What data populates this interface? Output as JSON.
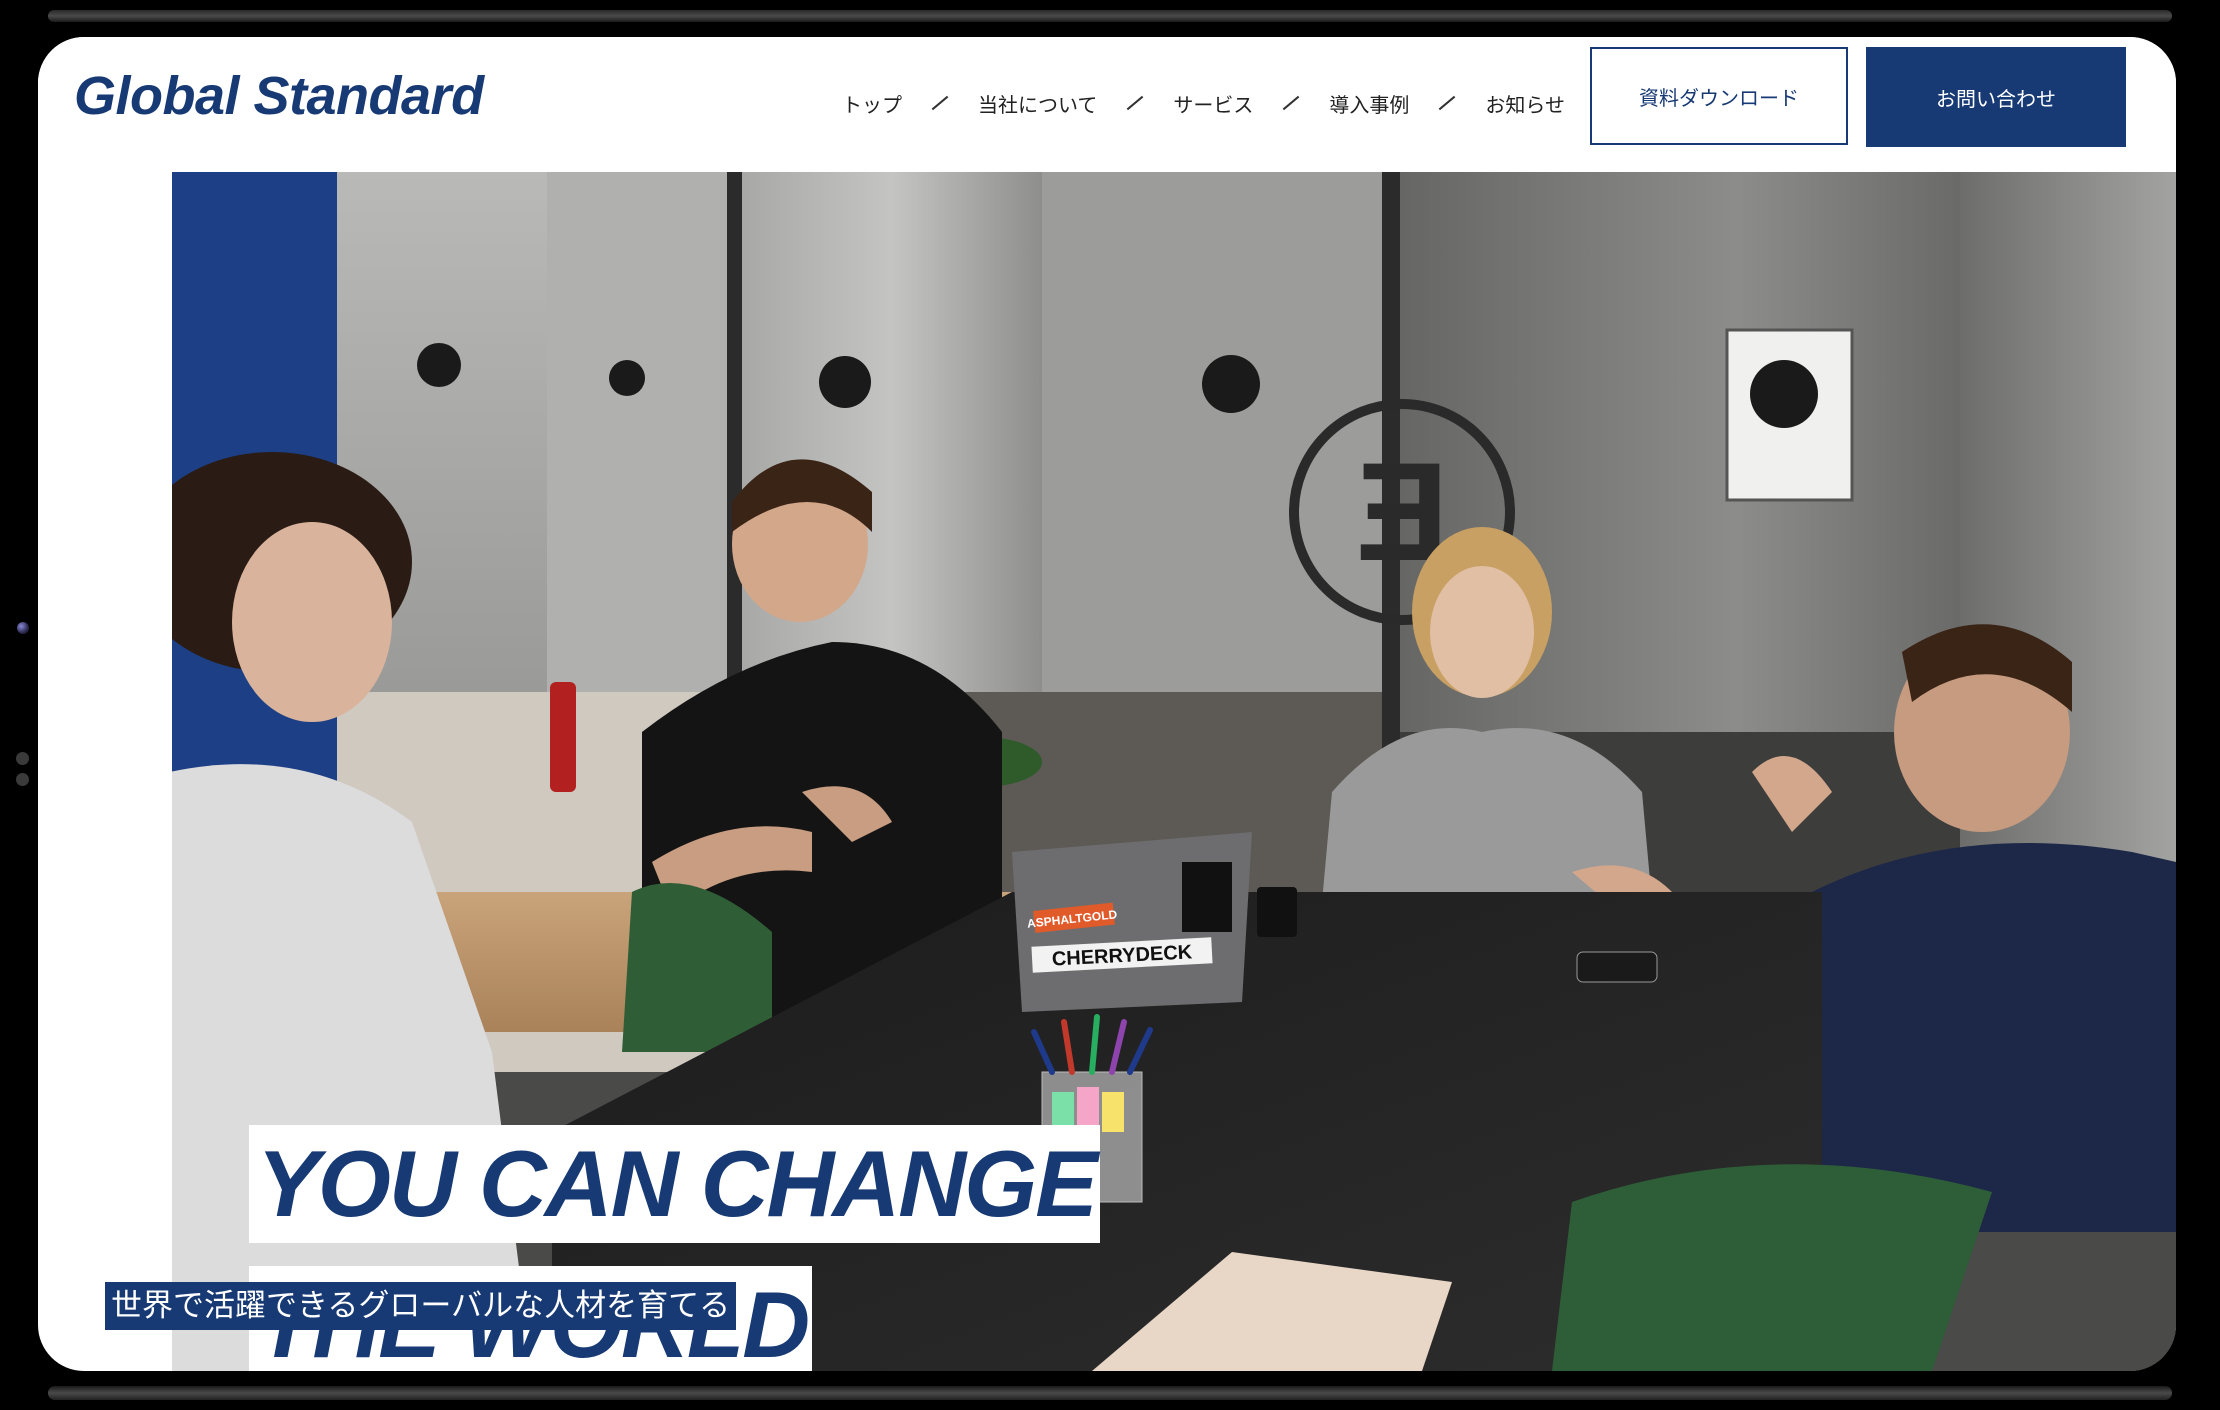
{
  "brand": {
    "logo_text": "Global Standard",
    "primary_color": "#173a74"
  },
  "nav": {
    "items": [
      {
        "label": "トップ"
      },
      {
        "label": "当社について"
      },
      {
        "label": "サービス"
      },
      {
        "label": "導入事例"
      },
      {
        "label": "お知らせ"
      }
    ]
  },
  "buttons": {
    "download_label": "資料ダウンロード",
    "contact_label": "お問い合わせ"
  },
  "hero": {
    "headline_line1": "YOU CAN CHANGE",
    "headline_line2": "THE WORLD",
    "subheadline": "世界で活躍できるグローバルな人材を育てる",
    "laptop_stickers": [
      "CHERRYDECK",
      "ASPHALTGOLD"
    ],
    "wall_logo": "E"
  }
}
